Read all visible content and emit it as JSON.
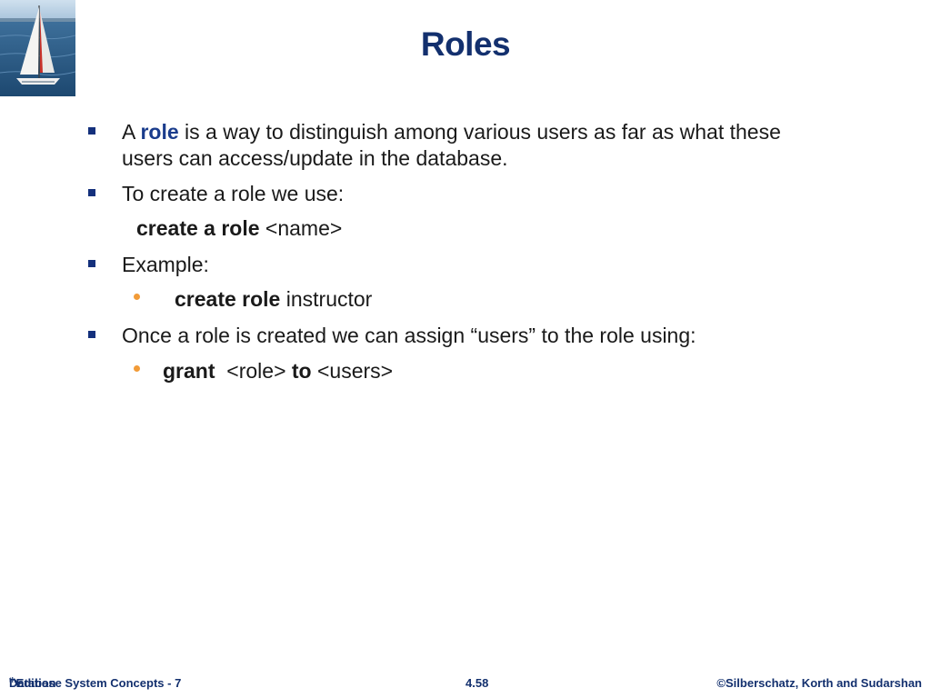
{
  "slide": {
    "title": "Roles"
  },
  "bullets": {
    "b1_a": "A ",
    "b1_keyword": "role",
    "b1_b": " is a way to distinguish among various users as far as what  these",
    "b1_line2": "users can access/update in the database.",
    "b2": "To create a role we use:",
    "b2_code_bold": "create a role",
    "b2_code_rest": " <name>",
    "b3": "Example:",
    "b3_sub_bold": "create role",
    "b3_sub_rest": " instructor",
    "b4": "Once a role is created we can assign “users” to the role using:",
    "b4_sub_bold1": "grant",
    "b4_sub_mid": "  <role> ",
    "b4_sub_bold2": "to",
    "b4_sub_rest": " <users>"
  },
  "footer": {
    "left_pre": "Database System Concepts - 7",
    "left_sup": "th",
    "left_post": " Edition",
    "center": "4.58",
    "right": "©Silberschatz, Korth and Sudarshan"
  },
  "colors": {
    "title": "#13306e",
    "keyword": "#1a3c8c",
    "bullet_square": "#14307c",
    "bullet_dot": "#f29b38"
  },
  "icons": {
    "logo": "sailboat-logo-icon"
  }
}
